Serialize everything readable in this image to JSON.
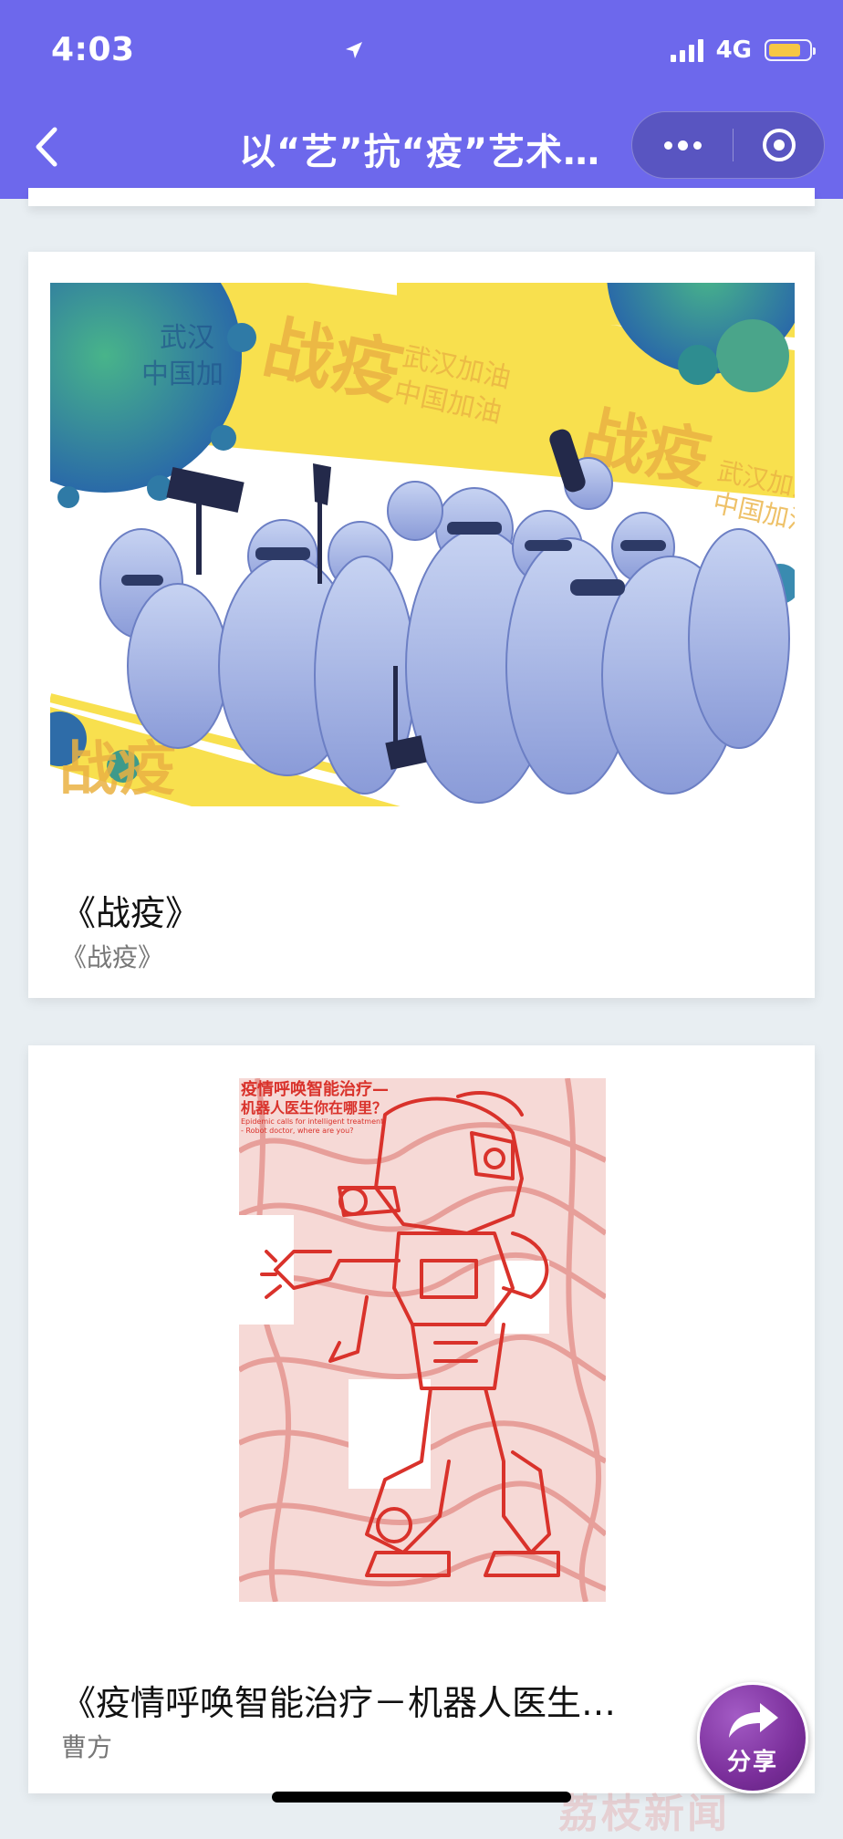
{
  "status_bar": {
    "time": "4:03",
    "network": "4G",
    "battery_level": 0.8
  },
  "nav": {
    "title": "以“艺”抗“疫”艺术…"
  },
  "colors": {
    "header": "#6d68ec",
    "page_bg": "#e8eef2",
    "art1_yellow": "#f8e04e",
    "art1_blue": "#9fb0e4",
    "art2_red": "#d9322b"
  },
  "cards": [
    {
      "title": "《战疫》",
      "subtitle": "《战疫》",
      "art_text": {
        "big1": "战疫",
        "small1a": "武汉加油",
        "small1b": "中国加油",
        "big2": "战疫",
        "small2a": "武汉加油",
        "small2b": "中国加油",
        "big3": "战疫",
        "small3": "武汉",
        "small3b": "中国加"
      }
    },
    {
      "title": "《疫情呼唤智能治疗－机器人医生…",
      "subtitle": "曹方",
      "art_text": {
        "line1": "疫情呼唤智能治疗—",
        "line2": "机器人医生你在哪里？",
        "line3": "Epidemic calls for intelligent treatment",
        "line4": "- Robot doctor, where are you?"
      }
    }
  ],
  "share": {
    "label": "分享"
  },
  "watermark": "荔枝新闻"
}
